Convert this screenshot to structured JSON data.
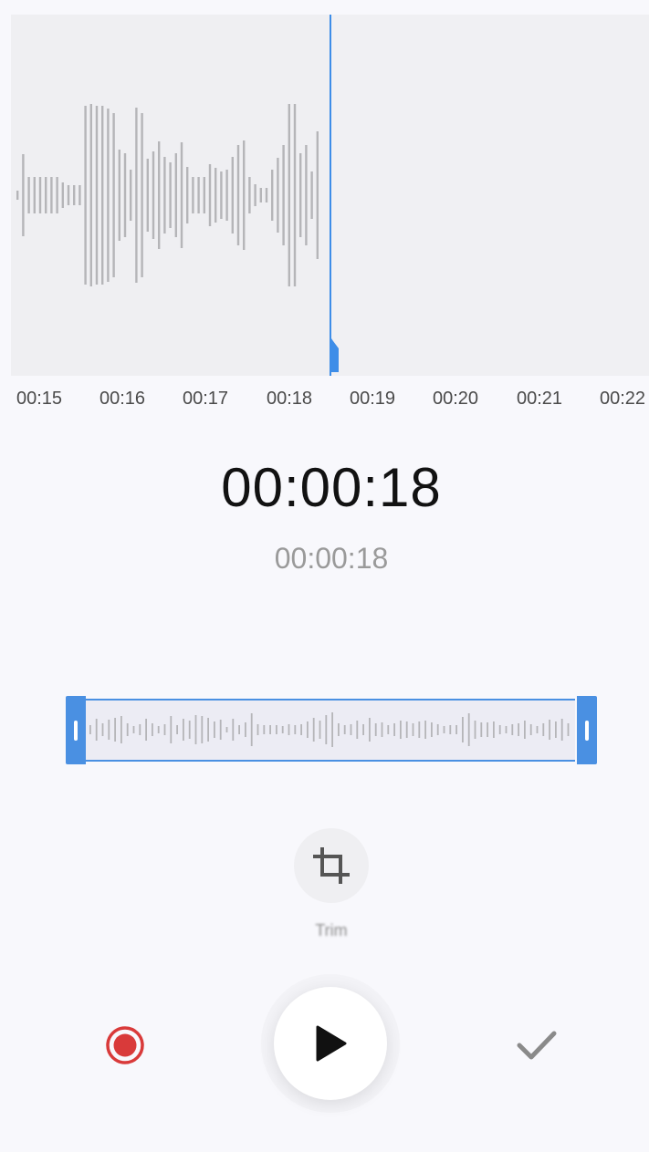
{
  "waveform": {
    "accent_color": "#3d8de8",
    "bar_color": "#b5b5b8"
  },
  "timeline": {
    "ticks": [
      "00:15",
      "00:16",
      "00:17",
      "00:18",
      "00:19",
      "00:20",
      "00:21",
      "00:22"
    ]
  },
  "time": {
    "current": "00:00:18",
    "total": "00:00:18"
  },
  "trim": {
    "label": "Trim",
    "icon": "crop-icon"
  },
  "controls": {
    "record_icon": "record-icon",
    "play_icon": "play-icon",
    "done_icon": "check-icon",
    "record_color": "#d93a3a"
  }
}
